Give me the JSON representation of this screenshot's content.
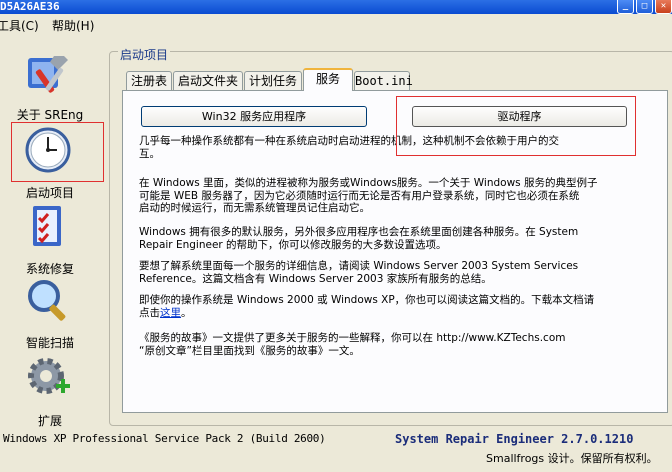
{
  "window": {
    "title": "D5A26AE36"
  },
  "menu": {
    "tools": "工具(C)",
    "help": "帮助(H)"
  },
  "sidebar": {
    "items": [
      {
        "label": "关于 SREng",
        "icon": "tools-icon"
      },
      {
        "label": "启动项目",
        "icon": "clock-icon"
      },
      {
        "label": "系统修复",
        "icon": "checklist-icon"
      },
      {
        "label": "智能扫描",
        "icon": "magnifier-icon"
      },
      {
        "label": "扩展",
        "icon": "gear-plus-icon"
      }
    ]
  },
  "group_title": "启动项目",
  "tabs": [
    {
      "label": "注册表"
    },
    {
      "label": "启动文件夹"
    },
    {
      "label": "计划任务"
    },
    {
      "label": "服务"
    },
    {
      "label": "Boot.ini"
    }
  ],
  "buttons": {
    "win32": "Win32 服务应用程序",
    "driver": "驱动程序"
  },
  "paragraphs": {
    "p1": "几乎每一种操作系统都有一种在系统启动时启动进程的机制，这种机制不会依赖于用户的交\n互。",
    "p2": "在 Windows 里面，类似的进程被称为服务或Windows服务。一个关于 Windows 服务的典型例子\n可能是 WEB 服务器了，因为它必须随时运行而无论是否有用户登录系统，同时它也必须在系统\n启动的时候运行，而无需系统管理员记住启动它。",
    "p3": "Windows 拥有很多的默认服务，另外很多应用程序也会在系统里面创建各种服务。在 System\nRepair Engineer 的帮助下，你可以修改服务的大多数设置选项。",
    "p4": "要想了解系统里面每一个服务的详细信息，请阅读 Windows Server 2003 System Services\nReference。这篇文档含有 Windows Server 2003 家族所有服务的总结。",
    "p5a": "即使你的操作系统是 Windows 2000 或 Windows XP，你也可以阅读这篇文档的。下载本文档请\n点击",
    "p5link": "这里",
    "p5b": "。",
    "p6": "《服务的故事》一文提供了更多关于服务的一些解释，你可以在 http://www.KZTechs.com\n“原创文章”栏目里面找到《服务的故事》一文。"
  },
  "status": {
    "os": "Windows XP Professional Service Pack 2 (Build 2600)",
    "product": "System Repair Engineer 2.7.0.1210",
    "copyright": "Smallfrogs 设计。保留所有权利。"
  }
}
